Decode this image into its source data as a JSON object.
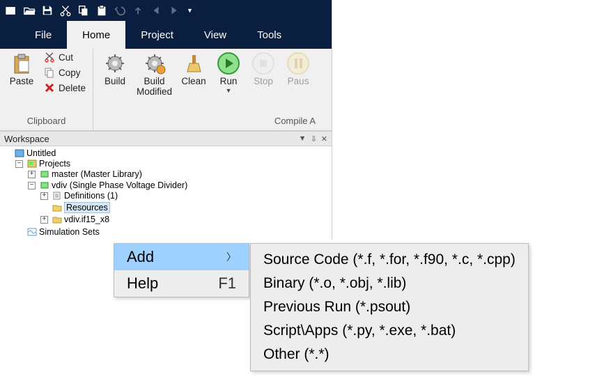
{
  "tabs": {
    "file": "File",
    "home": "Home",
    "project": "Project",
    "view": "View",
    "tools": "Tools"
  },
  "ribbon": {
    "clipboard": {
      "paste": "Paste",
      "cut": "Cut",
      "copy": "Copy",
      "delete": "Delete",
      "group": "Clipboard"
    },
    "build": {
      "build": "Build",
      "buildmod": "Build\nModified",
      "clean": "Clean"
    },
    "run": {
      "run": "Run",
      "stop": "Stop",
      "pause": "Paus",
      "group": "Compile A"
    }
  },
  "workspace": {
    "title": "Workspace"
  },
  "tree": {
    "untitled": "Untitled",
    "projects": "Projects",
    "master": "master (Master Library)",
    "vdiv": "vdiv (Single Phase Voltage Divider)",
    "definitions": "Definitions (1)",
    "resources": "Resources",
    "vdivif": "vdiv.if15_x8",
    "simsets": "Simulation Sets"
  },
  "ctx": {
    "add": "Add",
    "help": "Help",
    "helpkey": "F1"
  },
  "submenu": {
    "source": "Source Code (*.f, *.for, *.f90, *.c, *.cpp)",
    "binary": "Binary (*.o, *.obj, *.lib)",
    "prev": "Previous Run (*.psout)",
    "script": "Script\\Apps (*.py, *.exe, *.bat)",
    "other": "Other (*.*)"
  }
}
